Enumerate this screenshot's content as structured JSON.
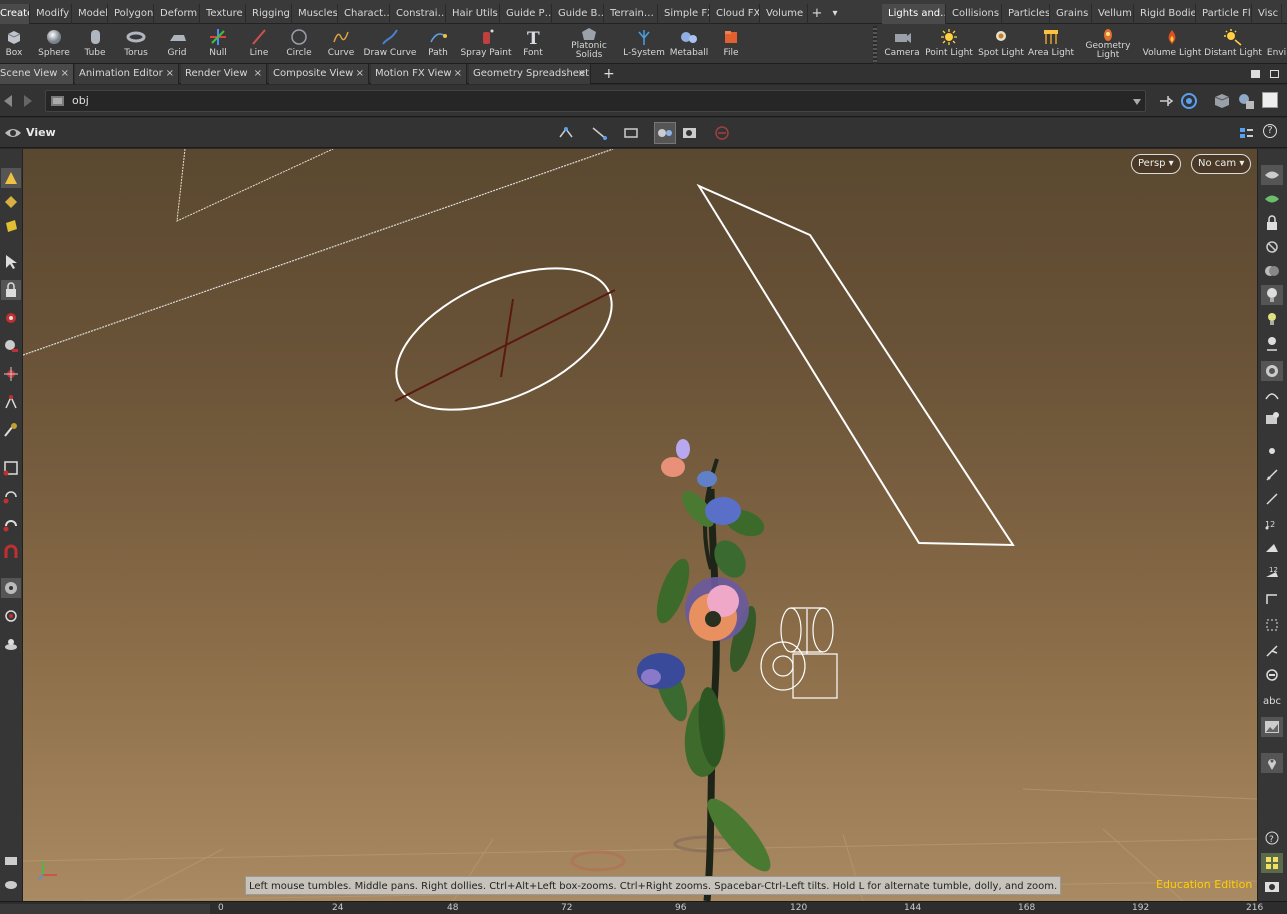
{
  "shelf": {
    "tabs_left": [
      "Create",
      "Modify",
      "Model",
      "Polygon",
      "Deform",
      "Texture",
      "Rigging",
      "Muscles",
      "Charact…",
      "Constrai…",
      "Hair Utils",
      "Guide P…",
      "Guide B…",
      "Terrain…",
      "Simple FX",
      "Cloud FX",
      "Volume"
    ],
    "tabs_right": [
      "Lights and…",
      "Collisions",
      "Particles",
      "Grains",
      "Vellum",
      "Rigid Bodies",
      "Particle Fl…",
      "Visc"
    ],
    "add_tab": "+",
    "menu_arrow": "▾",
    "tools_left": [
      "Box",
      "Sphere",
      "Tube",
      "Torus",
      "Grid",
      "Null",
      "Line",
      "Circle",
      "Curve",
      "Draw Curve",
      "Path",
      "Spray Paint",
      "Font",
      "Platonic Solids",
      "L-System",
      "Metaball",
      "File"
    ],
    "tools_right": [
      "Camera",
      "Point Light",
      "Spot Light",
      "Area Light",
      "Geometry Light",
      "Volume Light",
      "Distant Light",
      "Envi"
    ]
  },
  "panes": {
    "tabs": [
      "Scene View",
      "Animation Editor",
      "Render View",
      "Composite View",
      "Motion FX View",
      "Geometry Spreadsheet"
    ],
    "close_glyph": "×",
    "add": "+"
  },
  "path": {
    "value": "obj"
  },
  "viewer": {
    "title": "View",
    "persp_label": "Persp ▾",
    "cam_label": "No cam ▾"
  },
  "status": {
    "hint": "Left mouse tumbles. Middle pans. Right dollies. Ctrl+Alt+Left box-zooms. Ctrl+Right zooms. Spacebar-Ctrl-Left tilts. Hold L for alternate tumble, dolly, and zoom.",
    "edition": "Education Edition"
  },
  "right_toolbar": {
    "text_tool": "abc"
  },
  "timeline": {
    "ticks": [
      "0",
      "24",
      "48",
      "72",
      "96",
      "120",
      "144",
      "168",
      "192",
      "216"
    ]
  },
  "colors": {
    "accent": "#ffd000",
    "viewport_top": "#5a4830",
    "viewport_bottom": "#a98a62"
  }
}
